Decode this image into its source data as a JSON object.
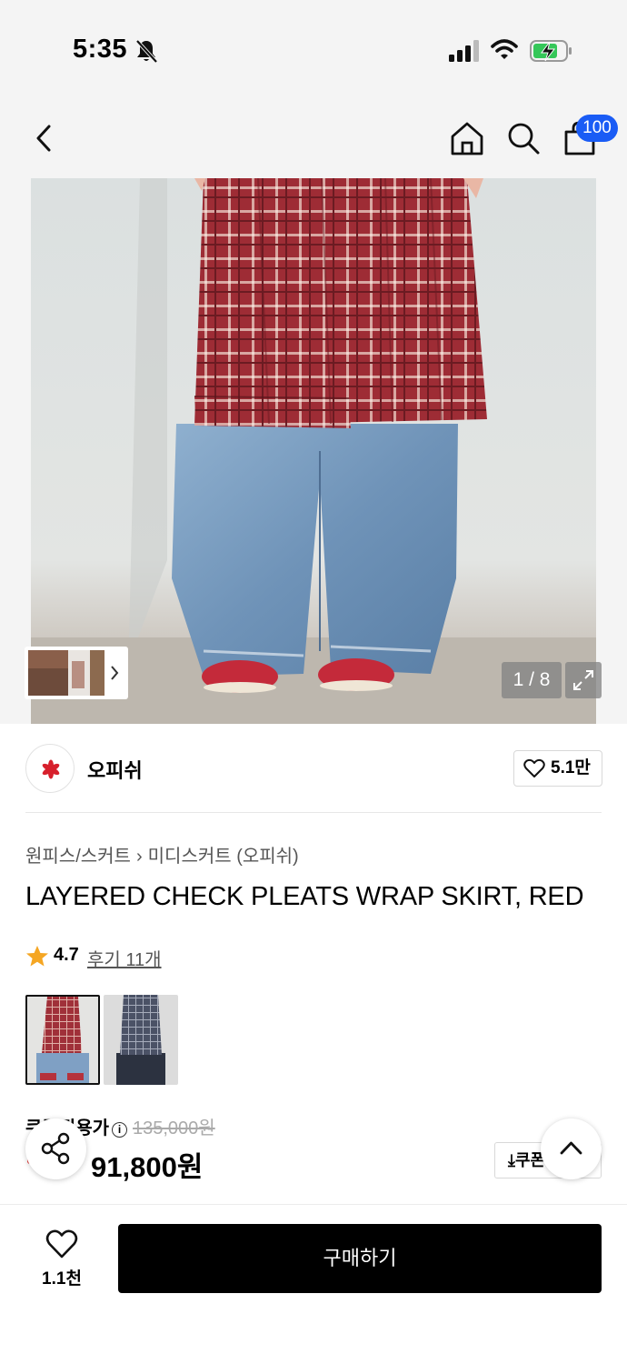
{
  "status": {
    "time": "5:35"
  },
  "header": {
    "cart_count": "100"
  },
  "gallery": {
    "counter": "1 / 8"
  },
  "brand": {
    "name": "오피쉬",
    "likes": "5.1만"
  },
  "breadcrumb": {
    "category": "원피스/스커트",
    "subcategory": "미디스커트 (오피쉬)"
  },
  "product": {
    "title": "LAYERED CHECK PLEATS WRAP SKIRT, RED"
  },
  "rating": {
    "score": "4.7",
    "reviews": "후기 11개"
  },
  "price": {
    "label": "쿠폰적용가",
    "original": "135,000원",
    "sale": "91,800원",
    "coupon": "쿠폰"
  },
  "bottom": {
    "wish_count": "1.1천",
    "buy_label": "구매하기"
  },
  "colors": {
    "badge": "#1a5cf5",
    "sale_red": "#e3322f",
    "star": "#f5a623",
    "check_red": "#a8323a"
  }
}
